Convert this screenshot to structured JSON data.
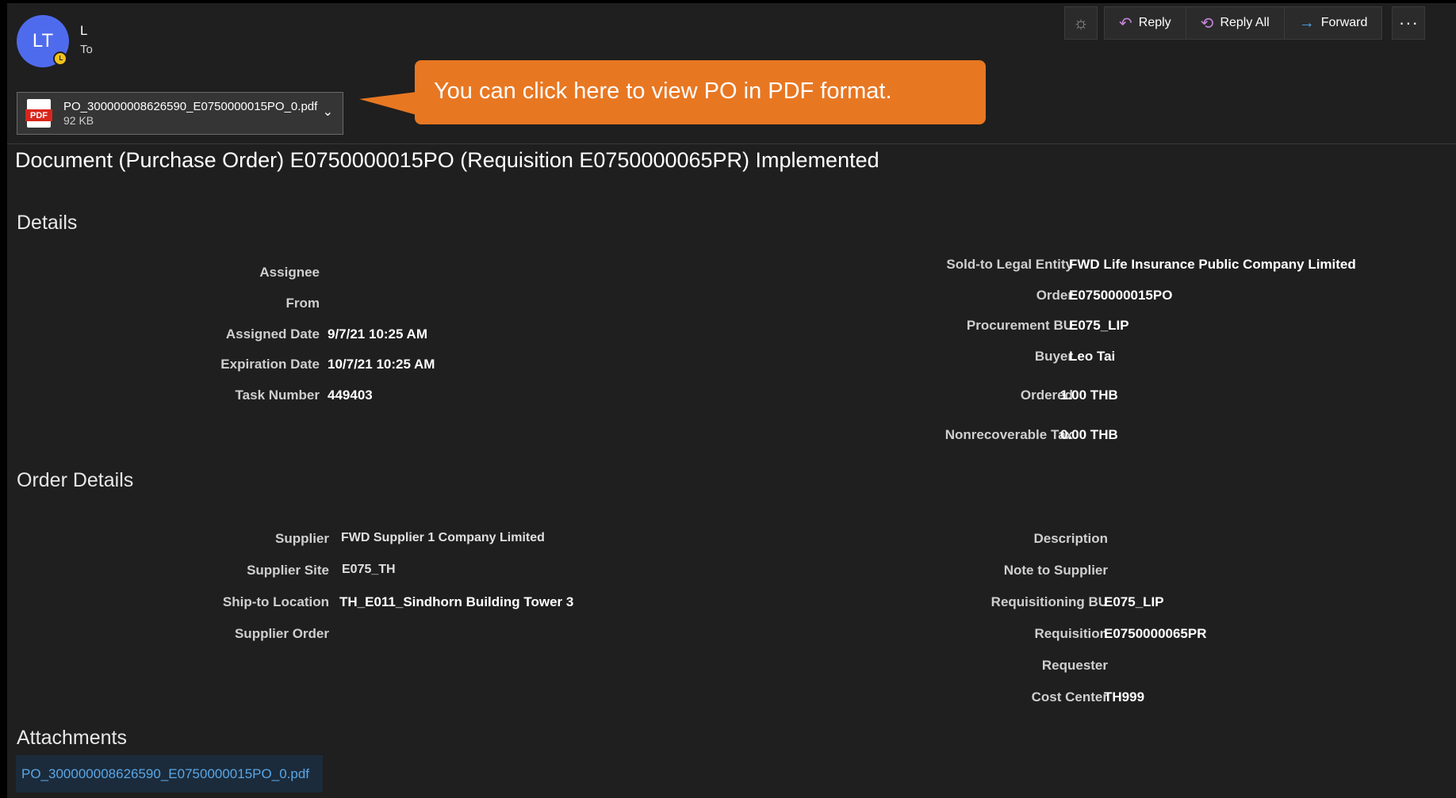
{
  "sender": {
    "initials": "LT",
    "name": "L",
    "to_label": "To"
  },
  "toolbar": {
    "reply_label": "Reply",
    "reply_all_label": "Reply All",
    "forward_label": "Forward",
    "more_label": "···"
  },
  "attachment_chip": {
    "icon_label": "PDF",
    "file_name": "PO_300000008626590_E0750000015PO_0.pdf",
    "file_size": "92 KB"
  },
  "callout": {
    "text": "You can click here to view PO in PDF format."
  },
  "subject": "Document (Purchase Order) E0750000015PO (Requisition E0750000065PR) Implemented",
  "details": {
    "title": "Details",
    "left": {
      "assignee_label": "Assignee",
      "assignee_value": "",
      "from_label": "From",
      "from_value": "",
      "assigned_date_label": "Assigned Date",
      "assigned_date_value": "9/7/21 10:25 AM",
      "expiration_date_label": "Expiration Date",
      "expiration_date_value": "10/7/21 10:25 AM",
      "task_number_label": "Task Number",
      "task_number_value": "449403"
    },
    "right": {
      "sold_to_label": "Sold-to Legal Entity",
      "sold_to_value": "FWD Life Insurance Public Company Limited",
      "order_label": "Order",
      "order_value": "E0750000015PO",
      "procurement_bu_label": "Procurement BU",
      "procurement_bu_value": "E075_LIP",
      "buyer_label": "Buyer",
      "buyer_value": "Leo Tai",
      "ordered_label": "Ordered",
      "ordered_value": "1.00 THB",
      "nonrecoverable_tax_label": "Nonrecoverable Tax",
      "nonrecoverable_tax_value": "0.00 THB"
    }
  },
  "order_details": {
    "title": "Order Details",
    "left": {
      "supplier_label": "Supplier",
      "supplier_value": "FWD Supplier 1 Company Limited",
      "supplier_site_label": "Supplier Site",
      "supplier_site_value": "E075_TH",
      "ship_to_label": "Ship-to Location",
      "ship_to_value": "TH_E011_Sindhorn Building Tower 3",
      "supplier_order_label": "Supplier Order",
      "supplier_order_value": ""
    },
    "right": {
      "description_label": "Description",
      "description_value": "",
      "note_label": "Note to Supplier",
      "note_value": "",
      "requisitioning_bu_label": "Requisitioning BU",
      "requisitioning_bu_value": "E075_LIP",
      "requisition_label": "Requisition",
      "requisition_value": "E0750000065PR",
      "requester_label": "Requester",
      "requester_value": "",
      "cost_center_label": "Cost Center",
      "cost_center_value": "TH999"
    }
  },
  "attachments": {
    "title": "Attachments",
    "link": "PO_300000008626590_E0750000015PO_0.pdf"
  },
  "colors": {
    "background": "#1f1f1f",
    "avatar": "#4f6bed",
    "callout": "#e87722",
    "link": "#5aa6e6",
    "reply_icon": "#c585d8",
    "forward_icon": "#4fa4e8"
  }
}
